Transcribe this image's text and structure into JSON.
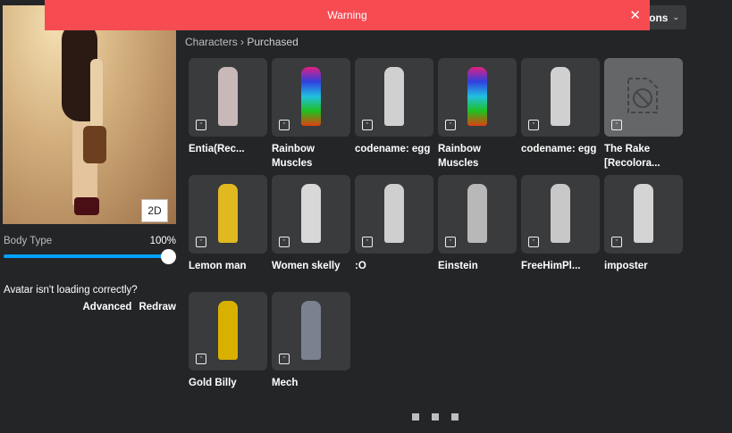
{
  "warning": {
    "text": "Warning",
    "close_icon": "close-icon"
  },
  "options_button": {
    "label": "ons"
  },
  "breadcrumb": {
    "parent": "Characters",
    "separator": "›",
    "current": "Purchased"
  },
  "avatar": {
    "toggle_label": "2D",
    "body_type_label": "Body Type",
    "body_type_value": "100%",
    "body_type_fraction": 1.0,
    "loading_question": "Avatar isn't loading correctly?",
    "advanced_label": "Advanced",
    "redraw_label": "Redraw"
  },
  "items": [
    {
      "name": "Entia(Rec...",
      "color": "#c9b8b8"
    },
    {
      "name": "Rainbow Muscles",
      "color": "linear-gradient(#e02080,#3040e0,#20c0e0,#20c020,#e04010)"
    },
    {
      "name": "codename: egg",
      "color": "#d0d0d0"
    },
    {
      "name": "Rainbow Muscles",
      "color": "linear-gradient(#e02080,#3040e0,#20c0e0,#20c020,#e04010)"
    },
    {
      "name": "codename: egg",
      "color": "#d0d0d0"
    },
    {
      "name": "The Rake [Recolora...",
      "blocked": true
    },
    {
      "name": "Lemon man",
      "color": "#e0b820"
    },
    {
      "name": "Women skelly",
      "color": "#d8d8d8"
    },
    {
      "name": ":O",
      "color": "#cfcfcf"
    },
    {
      "name": "Einstein",
      "color": "#b8b8b8"
    },
    {
      "name": "FreeHimPl...",
      "color": "#c8c8c8"
    },
    {
      "name": "imposter",
      "color": "#d4d4d4"
    },
    {
      "name": "Gold Billy",
      "color": "#d8b000"
    },
    {
      "name": "Mech",
      "color": "#7a8290"
    }
  ]
}
